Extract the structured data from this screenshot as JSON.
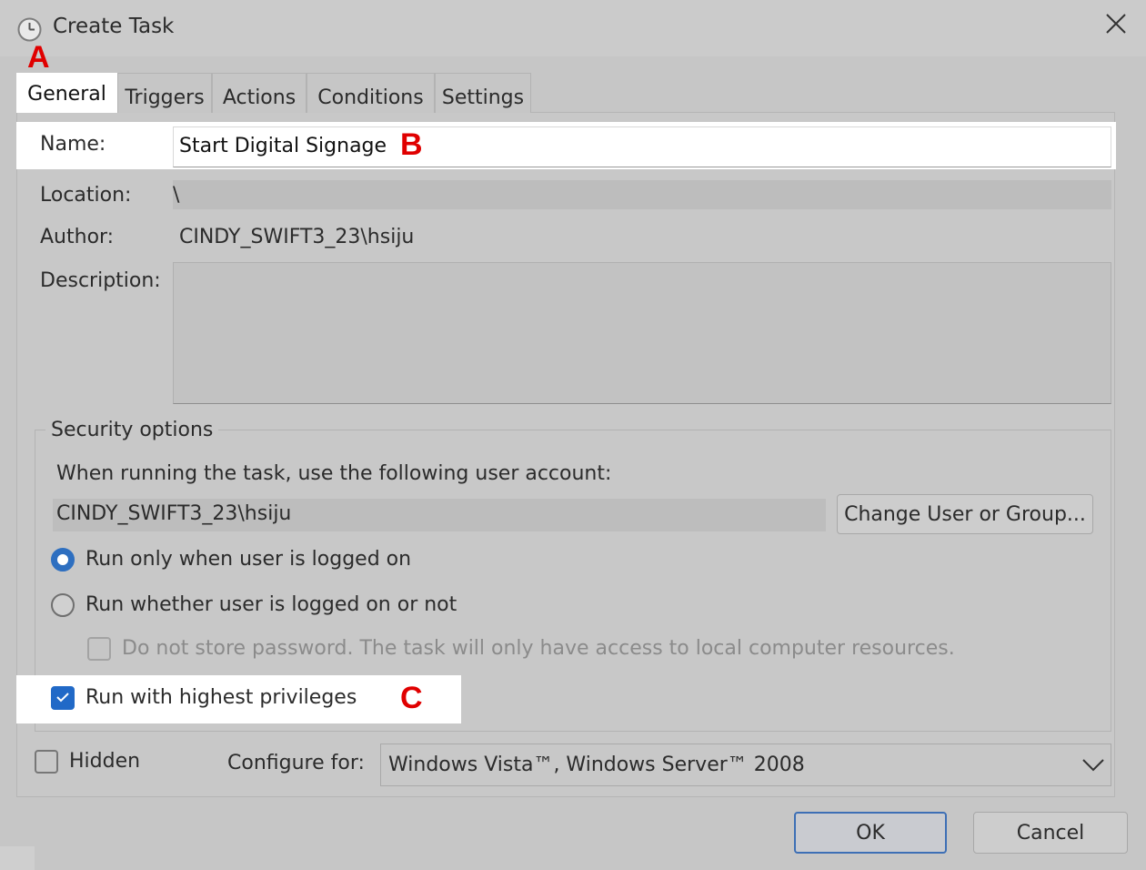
{
  "window": {
    "title": "Create Task",
    "icon": "clock-icon",
    "close_icon": "close-icon"
  },
  "markers": {
    "a": "A",
    "b": "B",
    "c": "C"
  },
  "tabs": [
    {
      "label": "General",
      "active": true
    },
    {
      "label": "Triggers",
      "active": false
    },
    {
      "label": "Actions",
      "active": false
    },
    {
      "label": "Conditions",
      "active": false
    },
    {
      "label": "Settings",
      "active": false
    }
  ],
  "general": {
    "name_label": "Name:",
    "name_value": "Start Digital Signage",
    "location_label": "Location:",
    "location_value": "\\",
    "author_label": "Author:",
    "author_value": "CINDY_SWIFT3_23\\hsiju",
    "description_label": "Description:",
    "description_value": ""
  },
  "security": {
    "legend": "Security options",
    "account_prompt": "When running the task, use the following user account:",
    "account_value": "CINDY_SWIFT3_23\\hsiju",
    "change_button": "Change User or Group...",
    "radio_logged_on": "Run only when user is logged on",
    "radio_logged_on_selected": true,
    "radio_whether": "Run whether user is logged on or not",
    "radio_whether_selected": false,
    "do_not_store": "Do not store password.  The task will only have access to local computer resources.",
    "do_not_store_checked": false,
    "highest_privileges": "Run with highest privileges",
    "highest_privileges_checked": true
  },
  "footer": {
    "hidden_label": "Hidden",
    "hidden_checked": false,
    "configure_label": "Configure for:",
    "configure_value": "Windows Vista™, Windows Server™ 2008",
    "ok": "OK",
    "cancel": "Cancel"
  },
  "colors": {
    "accent": "#2169c7",
    "marker": "#e00000"
  }
}
